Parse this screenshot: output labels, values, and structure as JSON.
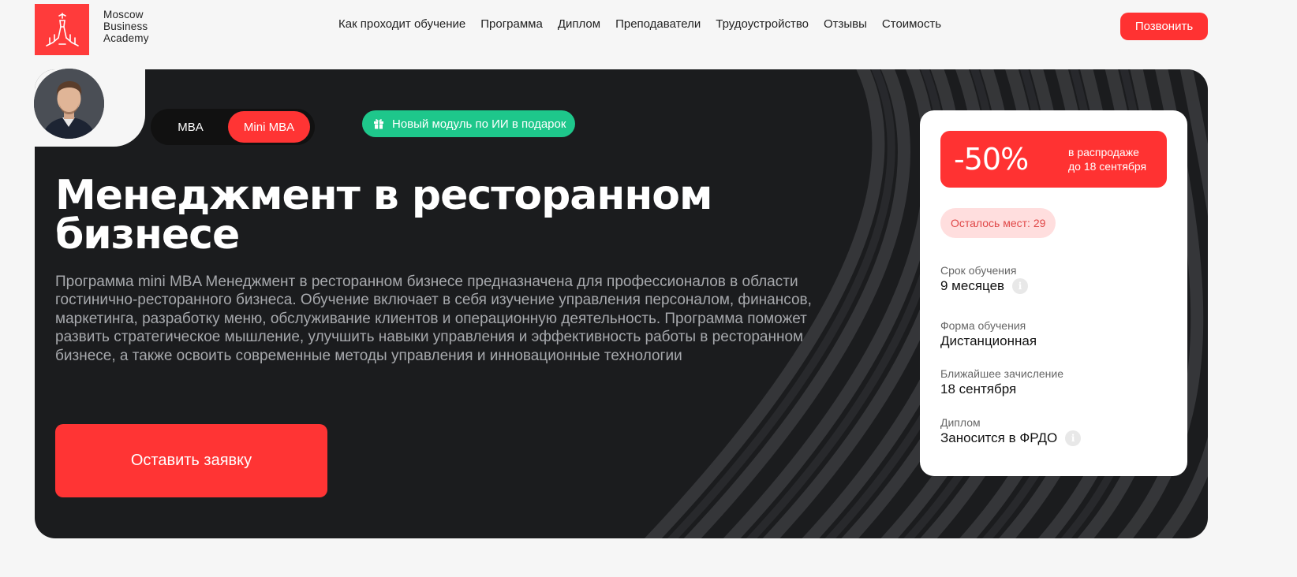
{
  "brand": {
    "name_lines": [
      "Moscow",
      "Business",
      "Academy"
    ],
    "color": "#ff3b3b",
    "logo_icon": "kremlin-tower-icon"
  },
  "nav": {
    "items": [
      "Как проходит обучение",
      "Программа",
      "Диплом",
      "Преподаватели",
      "Трудоустройство",
      "Отзывы",
      "Стоимость"
    ]
  },
  "header": {
    "call_label": "Позвонить"
  },
  "hero": {
    "toggle": {
      "options": [
        "MBA",
        "Mini MBA"
      ],
      "selected": "Mini MBA"
    },
    "gift_badge": {
      "label": "Новый модуль по ИИ в подарок",
      "icon": "gift-icon",
      "color": "#1ec78b"
    },
    "title_lines": [
      "Менеджмент в ресторанном",
      "бизнесе"
    ],
    "description": "Программа mini MBA Менеджмент в ресторанном бизнесе предназначена для профессионалов в области гостинично-ресторанного бизнеса. Обучение включает в себя изучение управления персоналом, финансов, маркетинга, разработку меню, обслуживание клиентов и операционную деятельность. Программа поможет развить стратегическое мышление, улучшить навыки управления и эффективность работы в ресторанном бизнесе, а также освоить современные методы управления и инновационные технологии",
    "apply_label": "Оставить заявку",
    "accent": "#ff3434"
  },
  "card": {
    "sale": {
      "percent": "-50%",
      "note_lines": [
        "в распродаже",
        "до 18 сентября"
      ]
    },
    "seats": "Осталось мест: 29",
    "rows": [
      {
        "label": "Срок обучения",
        "value": "9 месяцев",
        "info": true
      },
      {
        "label": "Форма обучения",
        "value": "Дистанционная",
        "info": false
      },
      {
        "label": "Ближайшее зачисление",
        "value": "18 сентября",
        "info": false
      },
      {
        "label": "Диплом",
        "value": "Заносится в ФРДО",
        "info": true
      }
    ],
    "info_glyph": "i"
  }
}
